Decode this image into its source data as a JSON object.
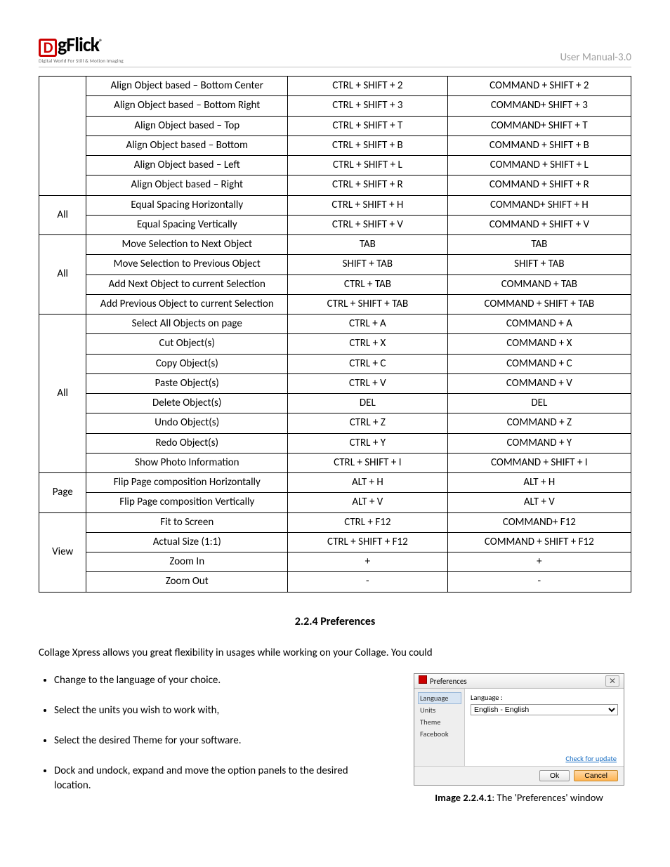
{
  "header": {
    "logo_text": "gFlick",
    "logo_letter": "D",
    "logo_tagline": "Digital World For Still & Motion Imaging",
    "manual_label": "User Manual-3.0"
  },
  "table": {
    "groups": [
      {
        "label": "",
        "rows": [
          {
            "action": "Align Object based – Bottom Center",
            "win": "CTRL + SHIFT + 2",
            "mac": "COMMAND + SHIFT + 2"
          },
          {
            "action": "Align Object based – Bottom Right",
            "win": "CTRL + SHIFT + 3",
            "mac": "COMMAND+ SHIFT + 3"
          },
          {
            "action": "Align Object based – Top",
            "win": "CTRL + SHIFT + T",
            "mac": "COMMAND+ SHIFT + T"
          },
          {
            "action": "Align Object based – Bottom",
            "win": "CTRL + SHIFT + B",
            "mac": "COMMAND + SHIFT + B"
          },
          {
            "action": "Align Object based – Left",
            "win": "CTRL + SHIFT + L",
            "mac": "COMMAND + SHIFT + L"
          },
          {
            "action": "Align Object based – Right",
            "win": "CTRL + SHIFT + R",
            "mac": "COMMAND + SHIFT + R"
          }
        ]
      },
      {
        "label": "All",
        "rows": [
          {
            "action": "Equal Spacing Horizontally",
            "win": "CTRL + SHIFT + H",
            "mac": "COMMAND+ SHIFT + H"
          },
          {
            "action": "Equal Spacing Vertically",
            "win": "CTRL + SHIFT + V",
            "mac": "COMMAND + SHIFT + V"
          }
        ]
      },
      {
        "label": "All",
        "rows": [
          {
            "action": "Move Selection to Next Object",
            "win": "TAB",
            "mac": "TAB"
          },
          {
            "action": "Move Selection to Previous Object",
            "win": "SHIFT + TAB",
            "mac": "SHIFT + TAB"
          },
          {
            "action": "Add Next Object to current Selection",
            "win": "CTRL + TAB",
            "mac": "COMMAND + TAB"
          },
          {
            "action": "Add Previous Object to current Selection",
            "win": "CTRL + SHIFT + TAB",
            "mac": "COMMAND + SHIFT + TAB"
          }
        ]
      },
      {
        "label": "All",
        "rows": [
          {
            "action": "Select All Objects on page",
            "win": "CTRL + A",
            "mac": "COMMAND + A"
          },
          {
            "action": "Cut Object(s)",
            "win": "CTRL + X",
            "mac": "COMMAND + X"
          },
          {
            "action": "Copy Object(s)",
            "win": "CTRL + C",
            "mac": "COMMAND + C"
          },
          {
            "action": "Paste Object(s)",
            "win": "CTRL + V",
            "mac": "COMMAND + V"
          },
          {
            "action": "Delete Object(s)",
            "win": "DEL",
            "mac": "DEL"
          },
          {
            "action": "Undo Object(s)",
            "win": "CTRL + Z",
            "mac": "COMMAND + Z"
          },
          {
            "action": "Redo Object(s)",
            "win": "CTRL + Y",
            "mac": "COMMAND + Y"
          },
          {
            "action": "Show Photo Information",
            "win": "CTRL + SHIFT + I",
            "mac": "COMMAND + SHIFT + I"
          }
        ]
      },
      {
        "label": "Page",
        "rows": [
          {
            "action": "Flip Page composition Horizontally",
            "win": "ALT + H",
            "mac": "ALT + H"
          },
          {
            "action": "Flip Page composition Vertically",
            "win": "ALT + V",
            "mac": "ALT + V"
          }
        ]
      },
      {
        "label": "View",
        "rows": [
          {
            "action": "Fit to Screen",
            "win": "CTRL + F12",
            "mac": "COMMAND+ F12"
          },
          {
            "action": "Actual Size (1:1)",
            "win": "CTRL + SHIFT + F12",
            "mac": "COMMAND + SHIFT + F12"
          },
          {
            "action": "Zoom In",
            "win": "+",
            "mac": "+"
          },
          {
            "action": "Zoom Out",
            "win": "-",
            "mac": "-"
          }
        ]
      }
    ]
  },
  "section": {
    "title": "2.2.4 Preferences",
    "intro": "Collage Xpress allows you great flexibility in usages while working on your Collage. You could",
    "bullets": [
      "Change to the language of your choice.",
      "Select the units you wish to work with,",
      "Select the desired Theme for your software.",
      "Dock and undock, expand and move the option panels to the desired location."
    ]
  },
  "figure": {
    "window_title": "Preferences",
    "tabs": [
      "Language",
      "Units",
      "Theme",
      "Facebook"
    ],
    "field_label": "Language :",
    "field_value": "English - English",
    "check_update": "Check for update",
    "ok": "Ok",
    "cancel": "Cancel",
    "caption_bold": "Image 2.2.4.1",
    "caption_rest": ": The 'Preferences' window"
  }
}
